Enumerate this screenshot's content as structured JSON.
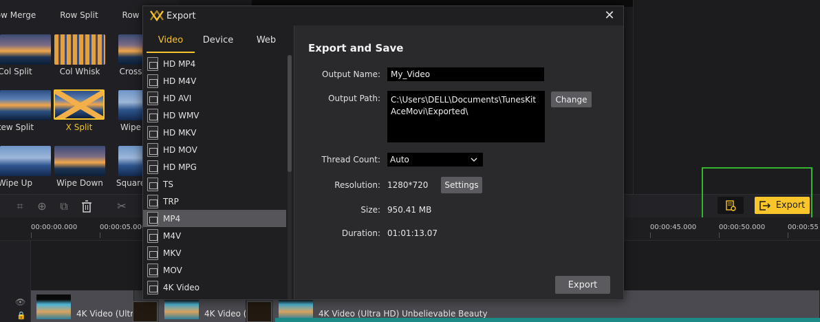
{
  "transitions": {
    "row1": [
      "ow Merge",
      "Row Split",
      "Row"
    ],
    "row2": [
      "Col Split",
      "Col Whisk",
      "Cross"
    ],
    "row3": [
      "kew Split",
      "X Split",
      "Wipe"
    ],
    "row4": [
      "Wipe Up",
      "Wipe Down",
      "Square"
    ],
    "selected": "X Split"
  },
  "toolbar": {
    "export_label": "Export"
  },
  "ruler": [
    "00:00:00.000",
    "00:00:05.000",
    "00:00:45.000",
    "00:00:50.000",
    "00:00:55"
  ],
  "timeline": {
    "clip1_label": "4K Video (Ultr",
    "clip2_label": "4K Video (",
    "clip3_label": "4K Video (Ultra HD) Unbelievable Beauty"
  },
  "dialog": {
    "title": "Export",
    "tabs": [
      "Video",
      "Device",
      "Web"
    ],
    "active_tab": "Video",
    "formats": [
      "HD MP4",
      "HD M4V",
      "HD AVI",
      "HD WMV",
      "HD MKV",
      "HD MOV",
      "HD MPG",
      "TS",
      "TRP",
      "MP4",
      "M4V",
      "MKV",
      "MOV",
      "4K Video"
    ],
    "selected_format": "MP4",
    "section_title": "Export and Save",
    "output_name_label": "Output Name:",
    "output_name_value": "My_Video",
    "output_path_label": "Output Path:",
    "output_path_value": "C:\\Users\\DELL\\Documents\\TunesKit AceMovi\\Exported\\",
    "change_button": "Change",
    "thread_count_label": "Thread Count:",
    "thread_count_value": "Auto",
    "resolution_label": "Resolution:",
    "resolution_value": "1280*720",
    "settings_button": "Settings",
    "size_label": "Size:",
    "size_value": "950.41 MB",
    "duration_label": "Duration:",
    "duration_value": "01:01:13.07",
    "export_button": "Export"
  },
  "colors": {
    "accent": "#f8c52b",
    "highlight": "#36b52f",
    "dialog_bg": "#2a2a2d"
  }
}
